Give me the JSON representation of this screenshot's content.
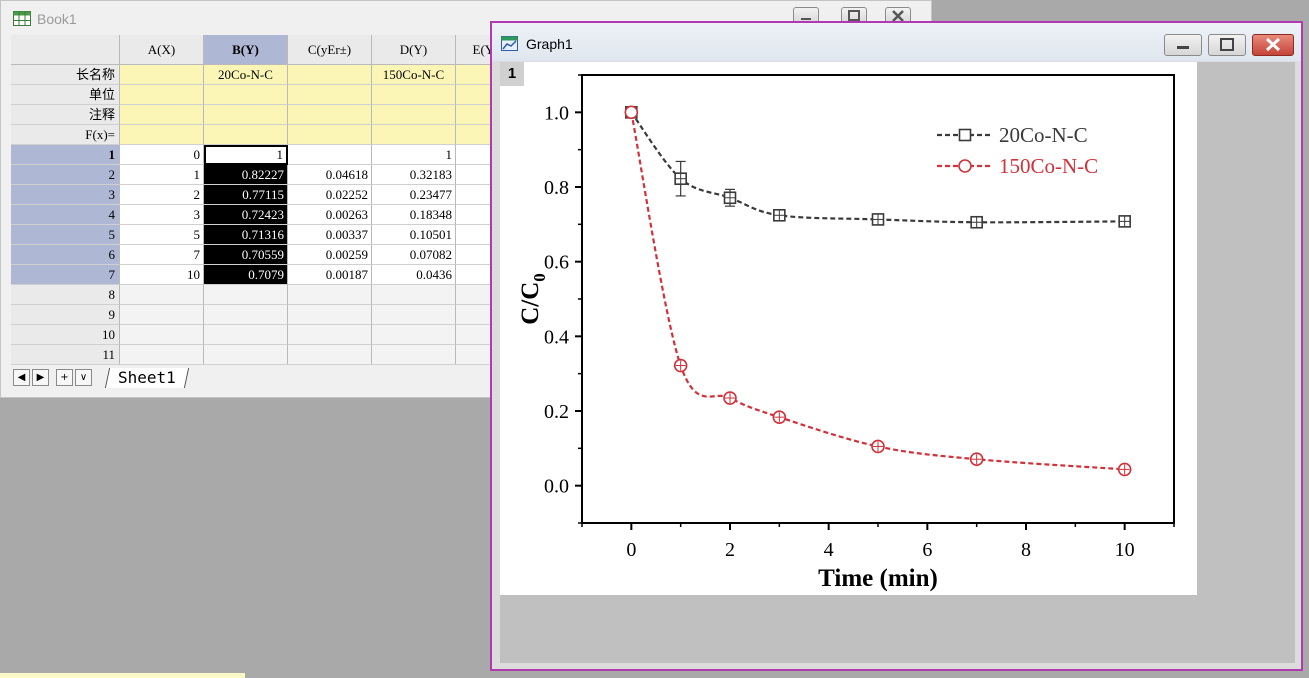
{
  "book": {
    "title": "Book1",
    "columns": [
      "A(X)",
      "B(Y)",
      "C(yEr±)",
      "D(Y)",
      "E(Y)"
    ],
    "meta_rows": [
      {
        "label": "长名称",
        "values": [
          "",
          "20Co-N-C",
          "",
          "150Co-N-C",
          ""
        ]
      },
      {
        "label": "单位",
        "values": [
          "",
          "",
          "",
          "",
          ""
        ]
      },
      {
        "label": "注释",
        "values": [
          "",
          "",
          "",
          "",
          ""
        ]
      },
      {
        "label": "F(x)=",
        "values": [
          "",
          "",
          "",
          "",
          ""
        ]
      }
    ],
    "rows": [
      {
        "index": "1",
        "A": "0",
        "B": "1",
        "C": "",
        "D": "1"
      },
      {
        "index": "2",
        "A": "1",
        "B": "0.82227",
        "C": "0.04618",
        "D": "0.32183"
      },
      {
        "index": "3",
        "A": "2",
        "B": "0.77115",
        "C": "0.02252",
        "D": "0.23477"
      },
      {
        "index": "4",
        "A": "3",
        "B": "0.72423",
        "C": "0.00263",
        "D": "0.18348"
      },
      {
        "index": "5",
        "A": "5",
        "B": "0.71316",
        "C": "0.00337",
        "D": "0.10501"
      },
      {
        "index": "6",
        "A": "7",
        "B": "0.70559",
        "C": "0.00259",
        "D": "0.07082"
      },
      {
        "index": "7",
        "A": "10",
        "B": "0.7079",
        "C": "0.00187",
        "D": "0.0436"
      }
    ],
    "empty_rows": [
      "8",
      "9",
      "10",
      "11"
    ],
    "sheet_tab": "Sheet1",
    "nav_buttons": [
      "◀",
      "▶",
      "+",
      "∨"
    ]
  },
  "graph": {
    "title": "Graph1",
    "layer": "1"
  },
  "chart_data": {
    "type": "line",
    "xlabel": "Time (min)",
    "ylabel_main": "C/C",
    "ylabel_sub": "0",
    "xlim": [
      -1,
      11
    ],
    "ylim": [
      -0.1,
      1.1
    ],
    "xticks": [
      0,
      2,
      4,
      6,
      8,
      10
    ],
    "yticks": [
      0.0,
      0.2,
      0.4,
      0.6,
      0.8,
      1.0
    ],
    "ytick_labels": [
      "0.0",
      "0.2",
      "0.4",
      "0.6",
      "0.8",
      "1.0"
    ],
    "x": [
      0,
      1,
      2,
      3,
      5,
      7,
      10
    ],
    "grid": false,
    "legend_position": "top-right",
    "series": [
      {
        "name": "20Co-N-C",
        "marker": "square",
        "color": "#3a3a3a",
        "values": [
          1,
          0.82227,
          0.77115,
          0.72423,
          0.71316,
          0.70559,
          0.7079
        ],
        "errors": [
          0,
          0.04618,
          0.02252,
          0.00263,
          0.00337,
          0.00259,
          0.00187
        ]
      },
      {
        "name": "150Co-N-C",
        "marker": "circle",
        "color": "#d0313a",
        "values": [
          1,
          0.32183,
          0.23477,
          0.18348,
          0.10501,
          0.07082,
          0.0436
        ]
      }
    ]
  }
}
